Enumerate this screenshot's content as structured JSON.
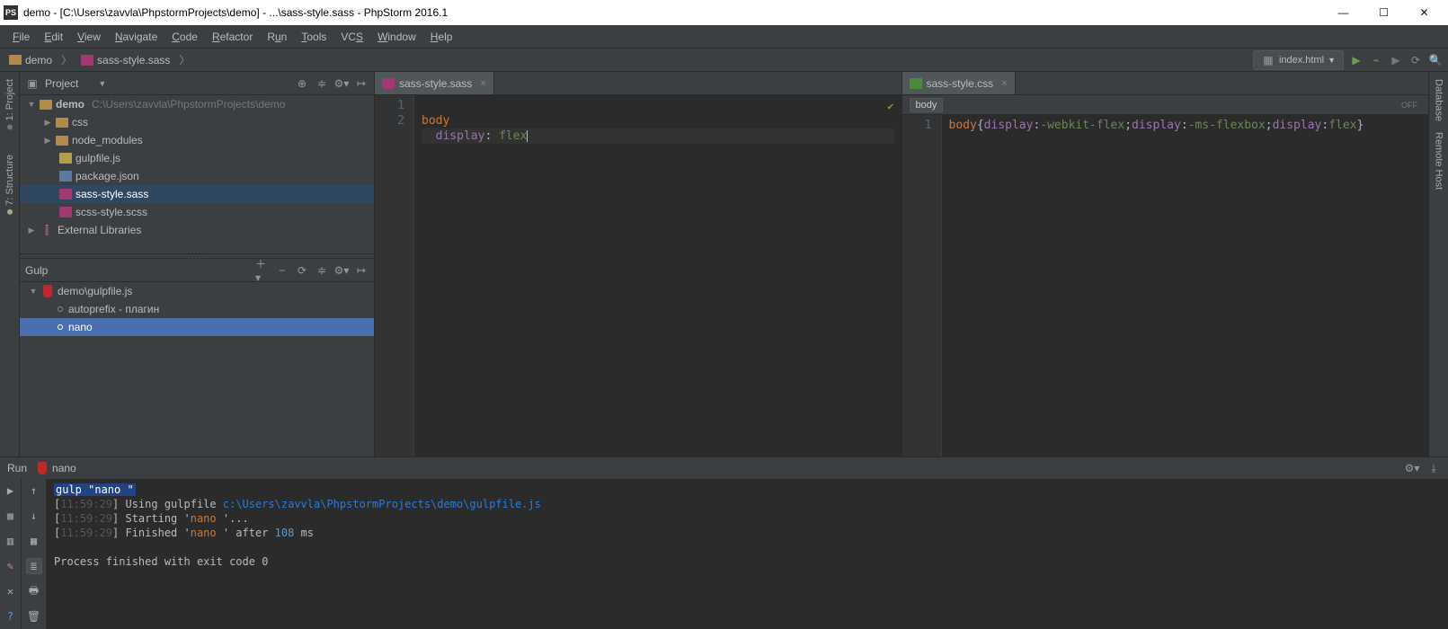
{
  "title": "demo - [C:\\Users\\zavvla\\PhpstormProjects\\demo] - ...\\sass-style.sass - PhpStorm 2016.1",
  "menu": [
    "File",
    "Edit",
    "View",
    "Navigate",
    "Code",
    "Refactor",
    "Run",
    "Tools",
    "VCS",
    "Window",
    "Help"
  ],
  "breadcrumbs": {
    "folder": "demo",
    "file": "sass-style.sass"
  },
  "nav_right": {
    "run_config": "index.html"
  },
  "project": {
    "title": "Project",
    "root": {
      "name": "demo",
      "path": "C:\\Users\\zavvla\\PhpstormProjects\\demo"
    },
    "items": [
      {
        "type": "dir",
        "name": "css"
      },
      {
        "type": "dir",
        "name": "node_modules"
      },
      {
        "type": "js",
        "name": "gulpfile.js"
      },
      {
        "type": "json",
        "name": "package.json"
      },
      {
        "type": "sass",
        "name": "sass-style.sass",
        "selected": true
      },
      {
        "type": "sass",
        "name": "scss-style.scss"
      }
    ],
    "external": "External Libraries"
  },
  "gulp": {
    "title": "Gulp",
    "root": "demo\\gulpfile.js",
    "tasks": [
      {
        "name": "autoprefix - плагин"
      },
      {
        "name": "nano",
        "selected": true
      }
    ]
  },
  "editor_left": {
    "tab": "sass-style.sass",
    "lines": [
      "body",
      "  display: flex"
    ]
  },
  "editor_right": {
    "tab": "sass-style.css",
    "breadcrumb": "body",
    "off": "OFF",
    "lines": [
      "body{display:-webkit-flex;display:-ms-flexbox;display:flex}"
    ]
  },
  "run": {
    "title": "Run",
    "config": "nano",
    "cmd": "gulp \"nano \"",
    "lines": [
      {
        "ts": "11:59:29",
        "kind": "using",
        "text_a": "Using gulpfile ",
        "path": "c:\\Users\\zavvla\\PhpstormProjects\\demo\\gulpfile.js"
      },
      {
        "ts": "11:59:29",
        "kind": "start",
        "text_a": "Starting '",
        "task": "nano ",
        "text_b": "'..."
      },
      {
        "ts": "11:59:29",
        "kind": "finish",
        "text_a": "Finished '",
        "task": "nano ",
        "text_b": "' after ",
        "num": "108",
        "unit": " ms"
      }
    ],
    "exit": "Process finished with exit code 0"
  },
  "side_labels": {
    "project": "1: Project",
    "structure": "7: Structure",
    "database": "Database",
    "remote": "Remote Host"
  }
}
